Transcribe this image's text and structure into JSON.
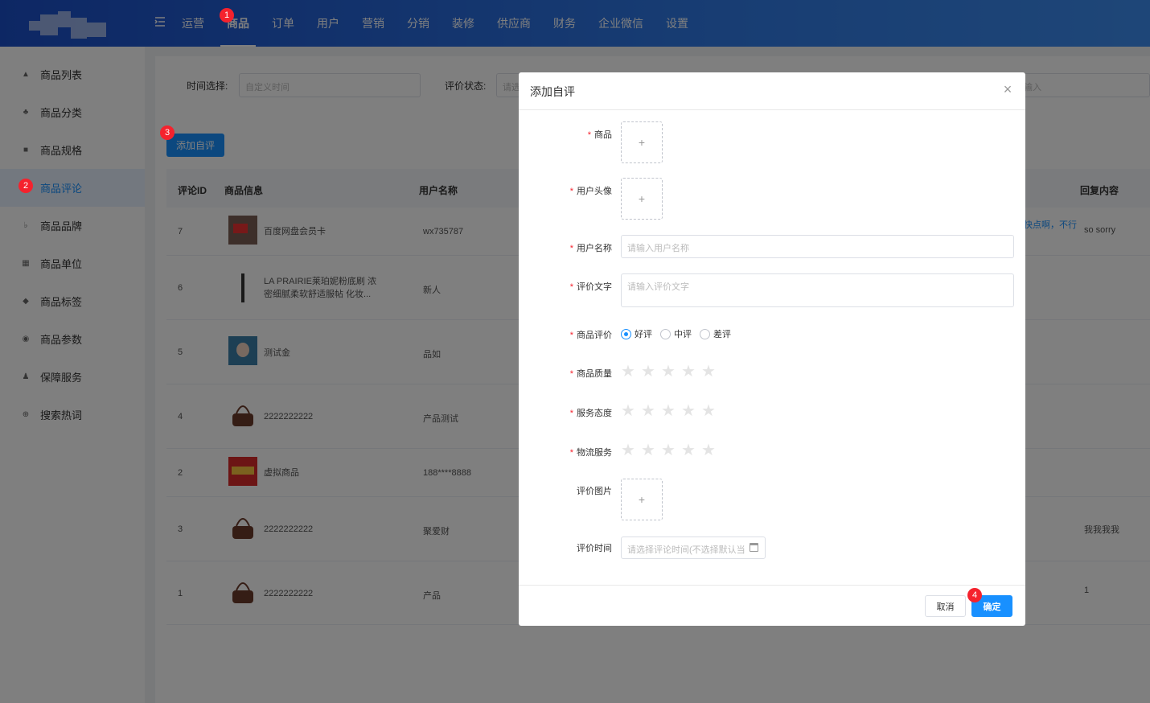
{
  "header": {
    "nav": [
      "运营",
      "商品",
      "订单",
      "用户",
      "营销",
      "分销",
      "装修",
      "供应商",
      "财务",
      "企业微信",
      "设置"
    ],
    "active_nav": "商品"
  },
  "sidebar": {
    "items": [
      "商品列表",
      "商品分类",
      "商品规格",
      "商品评论",
      "商品品牌",
      "商品单位",
      "商品标签",
      "商品参数",
      "保障服务",
      "搜索热词"
    ],
    "active_item": "商品评论"
  },
  "filter": {
    "time_label": "时间选择:",
    "time_placeholder": "自定义时间",
    "status_label": "评价状态:",
    "status_placeholder": "请选",
    "right_placeholder": "输入"
  },
  "toolbar": {
    "add_label": "添加自评"
  },
  "table": {
    "headers": {
      "id": "评论ID",
      "product": "商品信息",
      "user": "用户名称",
      "reply": "回复内容"
    },
    "rows": [
      {
        "id": "7",
        "product": "百度网盘会员卡",
        "user": "wx735787",
        "extra": "快点啊，不行",
        "reply": "so sorry"
      },
      {
        "id": "6",
        "product": "LA PRAIRIE莱珀妮粉底刷 浓密细腻柔软舒适服帖 化妆...",
        "user": "新人",
        "extra": "",
        "reply": ""
      },
      {
        "id": "5",
        "product": "测试金",
        "user": "品如",
        "extra": "",
        "reply": ""
      },
      {
        "id": "4",
        "product": "2222222222",
        "user": "产品测试",
        "extra": "",
        "reply": ""
      },
      {
        "id": "2",
        "product": "虚拟商品",
        "user": "188****8888",
        "extra": "",
        "reply": ""
      },
      {
        "id": "3",
        "product": "2222222222",
        "user": "聚爱财",
        "extra": "",
        "reply": "我我我我"
      },
      {
        "id": "1",
        "product": "2222222222",
        "user": "产品",
        "extra": "",
        "reply": "1"
      }
    ]
  },
  "modal": {
    "title": "添加自评",
    "fields": {
      "product": "商品",
      "avatar": "用户头像",
      "username": "用户名称",
      "username_placeholder": "请输入用户名称",
      "comment": "评价文字",
      "comment_placeholder": "请输入评价文字",
      "rating": "商品评价",
      "rating_options": [
        "好评",
        "中评",
        "差评"
      ],
      "quality": "商品质量",
      "service": "服务态度",
      "logistics": "物流服务",
      "images": "评价图片",
      "time": "评价时间",
      "time_placeholder": "请选择评论时间(不选择默认当"
    },
    "cancel_label": "取消",
    "ok_label": "确定"
  },
  "badges": [
    "1",
    "2",
    "3",
    "4"
  ],
  "colors": {
    "primary": "#1890ff",
    "header_start": "#1b4fc9",
    "header_end": "#3d8df0",
    "required": "#f5222d",
    "badge": "#f5222d"
  }
}
